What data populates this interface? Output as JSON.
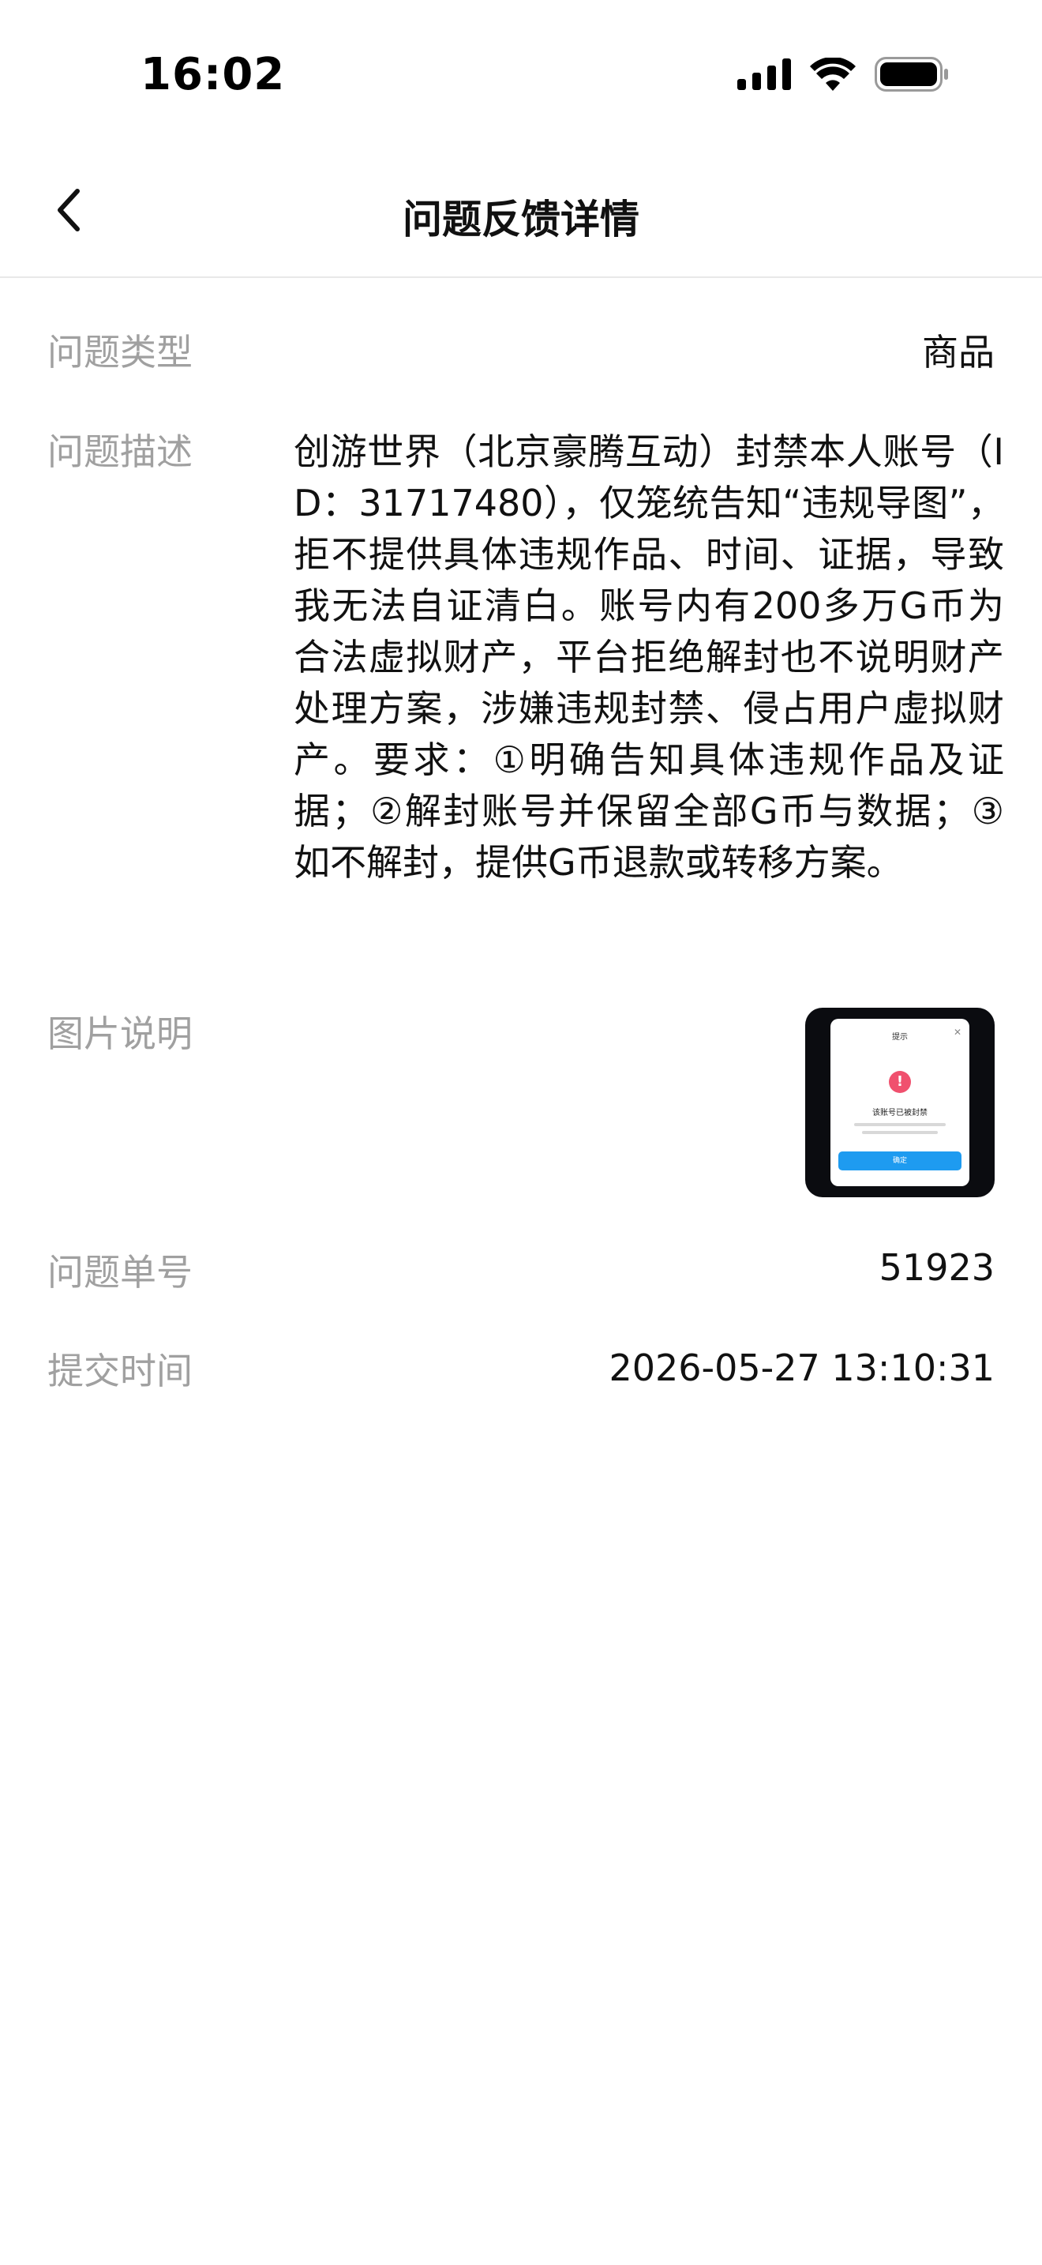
{
  "status_bar": {
    "time": "16:02",
    "icons": [
      "cellular-signal-icon",
      "wifi-icon",
      "battery-icon"
    ]
  },
  "nav": {
    "title": "问题反馈详情",
    "back_icon": "chevron-left-icon"
  },
  "feedback": {
    "type_label": "问题类型",
    "type_value": "商品",
    "desc_label": "问题描述",
    "desc_value": "创游世界（北京豪腾互动）封禁本人账号（ID：31717480），仅笼统告知“违规导图”，拒不提供具体违规作品、时间、证据，导致我无法自证清白。账号内有200多万G币为合法虚拟财产，平台拒绝解封也不说明财产处理方案，涉嫌违规封禁、侵占用户虚拟财产。要求：①明确告知具体违规作品及证据；②解封账号并保留全部G币与数据；③如不解封，提供G币退款或转移方案。",
    "image_label": "图片说明",
    "image_thumb": {
      "dialog_title": "提示",
      "dialog_message": "该账号已被封禁",
      "dialog_button": "确定"
    },
    "ticket_label": "问题单号",
    "ticket_value": "51923",
    "time_label": "提交时间",
    "time_value": "2026-05-27 13:10:31"
  },
  "colors": {
    "label_gray": "#a0a0a0",
    "text": "#111111",
    "divider": "#e8e8e8",
    "alert_red": "#f0506e",
    "button_blue": "#1e9bf0"
  }
}
